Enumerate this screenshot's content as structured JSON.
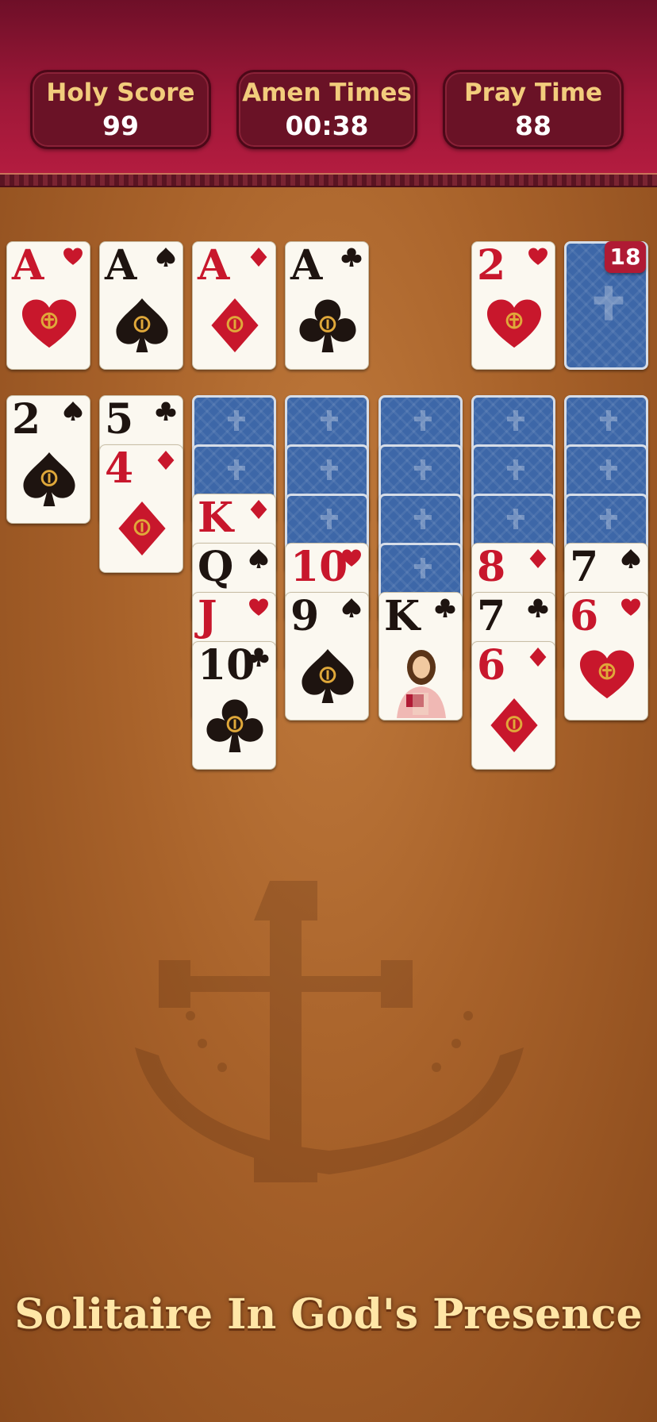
{
  "header": {
    "stats": [
      {
        "label": "Holy Score",
        "value": "99"
      },
      {
        "label": "Amen Times",
        "value": "00:38"
      },
      {
        "label": "Pray Time",
        "value": "88"
      }
    ]
  },
  "foundations": [
    {
      "rank": "A",
      "suit": "hearts"
    },
    {
      "rank": "A",
      "suit": "spades"
    },
    {
      "rank": "A",
      "suit": "diamonds"
    },
    {
      "rank": "A",
      "suit": "clubs"
    }
  ],
  "waste": {
    "rank": "2",
    "suit": "hearts"
  },
  "stock": {
    "count": "18"
  },
  "tableau": [
    {
      "face_down": 0,
      "face_up": [
        {
          "rank": "2",
          "suit": "spades"
        }
      ]
    },
    {
      "face_down": 0,
      "face_up": [
        {
          "rank": "5",
          "suit": "clubs"
        },
        {
          "rank": "4",
          "suit": "diamonds"
        }
      ]
    },
    {
      "face_down": 2,
      "face_up": [
        {
          "rank": "K",
          "suit": "diamonds"
        },
        {
          "rank": "Q",
          "suit": "spades"
        },
        {
          "rank": "J",
          "suit": "hearts"
        },
        {
          "rank": "10",
          "suit": "clubs"
        }
      ]
    },
    {
      "face_down": 3,
      "face_up": [
        {
          "rank": "10",
          "suit": "hearts"
        },
        {
          "rank": "9",
          "suit": "spades"
        }
      ]
    },
    {
      "face_down": 4,
      "face_up": [
        {
          "rank": "K",
          "suit": "clubs"
        }
      ]
    },
    {
      "face_down": 3,
      "face_up": [
        {
          "rank": "8",
          "suit": "diamonds"
        },
        {
          "rank": "7",
          "suit": "clubs"
        },
        {
          "rank": "6",
          "suit": "diamonds"
        }
      ]
    },
    {
      "face_down": 3,
      "face_up": [
        {
          "rank": "7",
          "suit": "spades"
        },
        {
          "rank": "6",
          "suit": "hearts"
        }
      ]
    }
  ],
  "tagline": "Solitaire In God's Presence",
  "colors": {
    "red_suit": "#c8172c",
    "black_suit": "#1e1410",
    "card_back": "#3d67a8",
    "header": "#9e1838",
    "gold_text": "#f2cc7c"
  }
}
